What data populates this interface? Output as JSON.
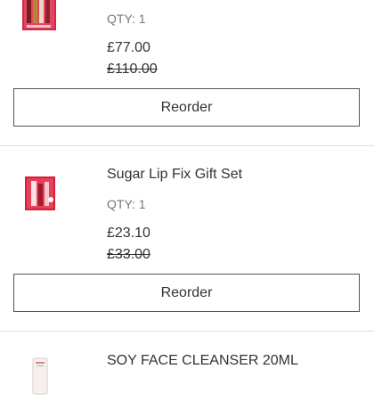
{
  "orders": [
    {
      "name": "",
      "qty": "QTY: 1",
      "price": "£77.00",
      "old_price": "£110.00",
      "reorder_label": "Reorder",
      "icon": "lip-gift-box-image"
    },
    {
      "name": "Sugar Lip Fix Gift Set",
      "qty": "QTY: 1",
      "price": "£23.10",
      "old_price": "£33.00",
      "reorder_label": "Reorder",
      "icon": "lip-fix-gift-set-image"
    },
    {
      "name": "SOY FACE CLEANSER 20ML",
      "icon": "cleanser-tube-image"
    }
  ]
}
